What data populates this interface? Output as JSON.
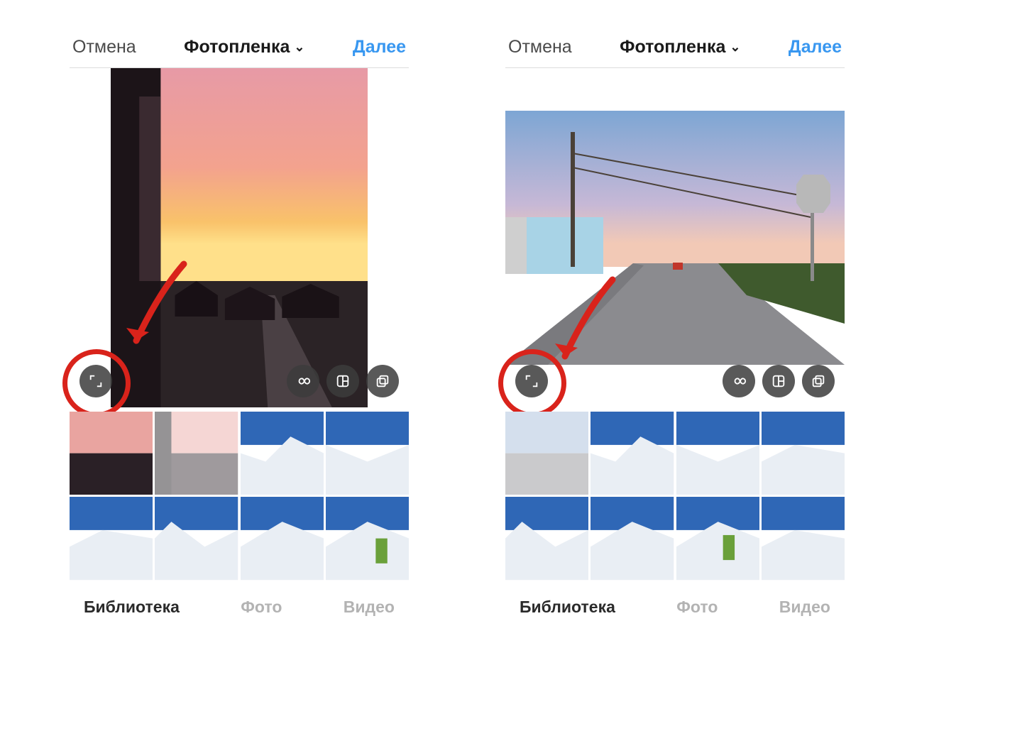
{
  "colors": {
    "accent_blue": "#3897f0",
    "annotation_red": "#d9231b"
  },
  "header": {
    "cancel_label": "Отмена",
    "title_label": "Фотопленка",
    "next_label": "Далее"
  },
  "overlay_buttons": {
    "expand": "expand-icon",
    "boomerang": "infinity-icon",
    "layout": "layout-icon",
    "multi": "multi-select-icon"
  },
  "tabs": {
    "library_label": "Библиотека",
    "photo_label": "Фото",
    "video_label": "Видео",
    "active_index": 0
  },
  "screens": [
    {
      "id": "left",
      "preview_kind": "sunset_portrait",
      "thumbnails": [
        {
          "kind": "sunset_a",
          "selected": false
        },
        {
          "kind": "sunset_b",
          "selected": true
        },
        {
          "kind": "mountain_peak",
          "selected": false
        },
        {
          "kind": "mountain_slope",
          "selected": false
        },
        {
          "kind": "mountain_pano_a",
          "selected": false
        },
        {
          "kind": "mountain_pano_b",
          "selected": false
        },
        {
          "kind": "mountain_pano_c",
          "selected": false
        },
        {
          "kind": "mountain_skier",
          "selected": false
        }
      ]
    },
    {
      "id": "right",
      "preview_kind": "beach_road_landscape",
      "thumbnails": [
        {
          "kind": "beach_road_thumb",
          "selected": true
        },
        {
          "kind": "mountain_peak",
          "selected": false
        },
        {
          "kind": "mountain_slope",
          "selected": false
        },
        {
          "kind": "mountain_slope_b",
          "selected": false
        },
        {
          "kind": "mountain_pano_a",
          "selected": false
        },
        {
          "kind": "mountain_pano_b",
          "selected": false
        },
        {
          "kind": "mountain_skier",
          "selected": false
        },
        {
          "kind": "mountain_pano_c",
          "selected": false
        }
      ]
    }
  ]
}
